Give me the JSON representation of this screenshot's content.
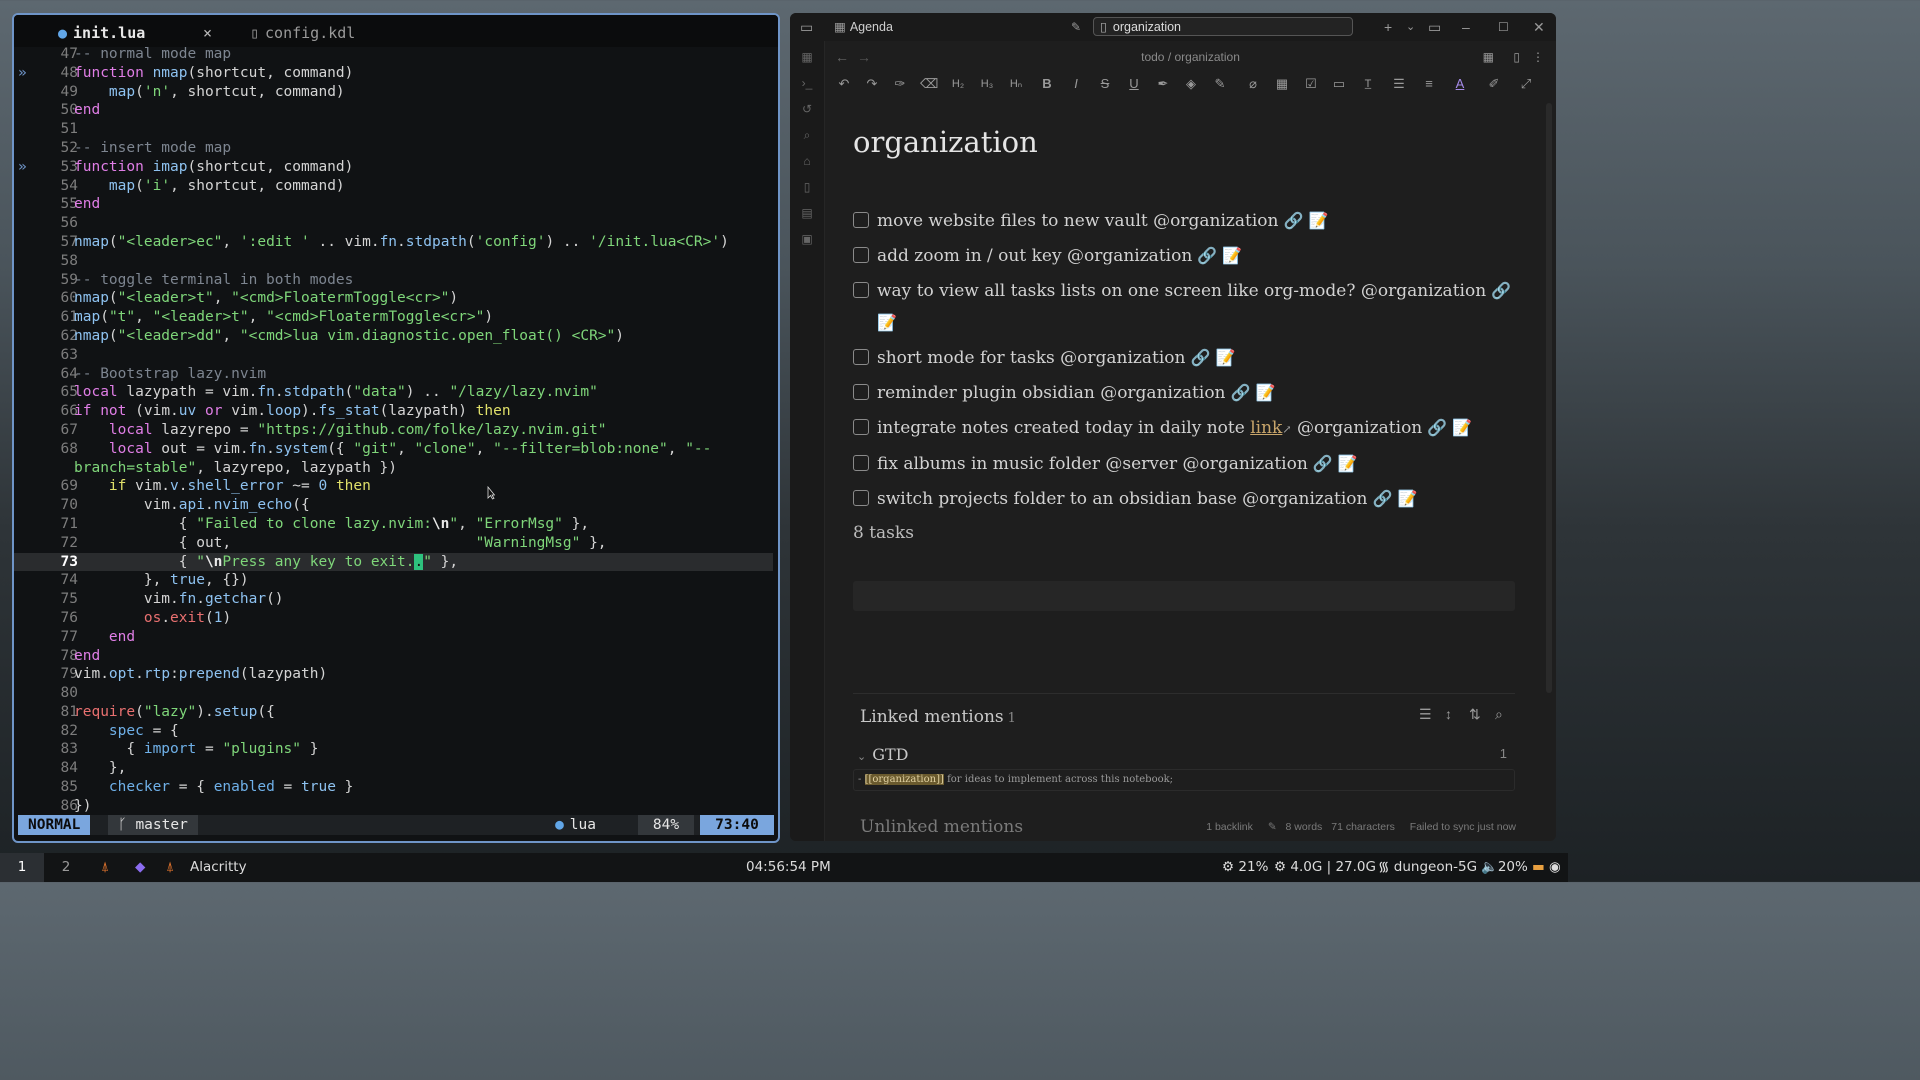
{
  "terminal": {
    "tabs": [
      {
        "label": "init.lua",
        "close": "×",
        "active": true
      },
      {
        "label": "config.kdl",
        "active": false
      }
    ],
    "lines": [
      {
        "n": "47",
        "t": [
          {
            "c": "cm",
            "s": "-- normal mode map"
          }
        ]
      },
      {
        "n": "48",
        "mark": "»",
        "t": [
          {
            "c": "kw",
            "s": "function"
          },
          {
            "s": " "
          },
          {
            "c": "fn",
            "s": "nmap"
          },
          {
            "s": "(shortcut, command)"
          }
        ]
      },
      {
        "n": "49",
        "t": [
          {
            "s": "    "
          },
          {
            "c": "fn",
            "s": "map"
          },
          {
            "s": "("
          },
          {
            "c": "str",
            "s": "'n'"
          },
          {
            "s": ", shortcut, command)"
          }
        ]
      },
      {
        "n": "50",
        "t": [
          {
            "c": "kw",
            "s": "end"
          }
        ]
      },
      {
        "n": "51",
        "t": []
      },
      {
        "n": "52",
        "t": [
          {
            "c": "cm",
            "s": "-- insert mode map"
          }
        ]
      },
      {
        "n": "53",
        "mark": "»",
        "t": [
          {
            "c": "kw",
            "s": "function"
          },
          {
            "s": " "
          },
          {
            "c": "fn",
            "s": "imap"
          },
          {
            "s": "(shortcut, command)"
          }
        ]
      },
      {
        "n": "54",
        "t": [
          {
            "s": "    "
          },
          {
            "c": "fn",
            "s": "map"
          },
          {
            "s": "("
          },
          {
            "c": "str",
            "s": "'i'"
          },
          {
            "s": ", shortcut, command)"
          }
        ]
      },
      {
        "n": "55",
        "t": [
          {
            "c": "kw",
            "s": "end"
          }
        ]
      },
      {
        "n": "56",
        "t": []
      },
      {
        "n": "57",
        "t": [
          {
            "c": "fn",
            "s": "nmap"
          },
          {
            "s": "("
          },
          {
            "c": "str",
            "s": "\"<leader>ec\""
          },
          {
            "s": ", "
          },
          {
            "c": "str",
            "s": "':edit '"
          },
          {
            "s": " .. vim."
          },
          {
            "c": "fn",
            "s": "fn"
          },
          {
            "s": "."
          },
          {
            "c": "fn",
            "s": "stdpath"
          },
          {
            "s": "("
          },
          {
            "c": "str",
            "s": "'config'"
          },
          {
            "s": ") .. "
          },
          {
            "c": "str",
            "s": "'/init.lua<CR>'"
          },
          {
            "s": ")"
          }
        ]
      },
      {
        "n": "58",
        "t": []
      },
      {
        "n": "59",
        "t": [
          {
            "c": "cm",
            "s": "-- toggle terminal in both modes"
          }
        ]
      },
      {
        "n": "60",
        "t": [
          {
            "c": "fn",
            "s": "nmap"
          },
          {
            "s": "("
          },
          {
            "c": "str",
            "s": "\"<leader>t\""
          },
          {
            "s": ", "
          },
          {
            "c": "str",
            "s": "\"<cmd>FloatermToggle<cr>\""
          },
          {
            "s": ")"
          }
        ]
      },
      {
        "n": "61",
        "t": [
          {
            "c": "fn",
            "s": "map"
          },
          {
            "s": "("
          },
          {
            "c": "str",
            "s": "\"t\""
          },
          {
            "s": ", "
          },
          {
            "c": "str",
            "s": "\"<leader>t\""
          },
          {
            "s": ", "
          },
          {
            "c": "str",
            "s": "\"<cmd>FloatermToggle<cr>\""
          },
          {
            "s": ")"
          }
        ]
      },
      {
        "n": "62",
        "t": [
          {
            "c": "fn",
            "s": "nmap"
          },
          {
            "s": "("
          },
          {
            "c": "str",
            "s": "\"<leader>dd\""
          },
          {
            "s": ", "
          },
          {
            "c": "str",
            "s": "\"<cmd>lua vim.diagnostic.open_float() <CR>\""
          },
          {
            "s": ")"
          }
        ]
      },
      {
        "n": "63",
        "t": []
      },
      {
        "n": "64",
        "t": [
          {
            "c": "cm",
            "s": "-- Bootstrap lazy.nvim"
          }
        ]
      },
      {
        "n": "65",
        "t": [
          {
            "c": "kw",
            "s": "local"
          },
          {
            "s": " lazypath = vim."
          },
          {
            "c": "fn",
            "s": "fn"
          },
          {
            "s": "."
          },
          {
            "c": "fn",
            "s": "stdpath"
          },
          {
            "s": "("
          },
          {
            "c": "str",
            "s": "\"data\""
          },
          {
            "s": ") .. "
          },
          {
            "c": "str",
            "s": "\"/lazy/lazy.nvim\""
          }
        ]
      },
      {
        "n": "66",
        "t": [
          {
            "c": "kw",
            "s": "if"
          },
          {
            "s": " "
          },
          {
            "c": "kw",
            "s": "not"
          },
          {
            "s": " (vim."
          },
          {
            "c": "fn",
            "s": "uv"
          },
          {
            "s": " "
          },
          {
            "c": "kw",
            "s": "or"
          },
          {
            "s": " vim."
          },
          {
            "c": "fn",
            "s": "loop"
          },
          {
            "s": ")."
          },
          {
            "c": "fn",
            "s": "fs_stat"
          },
          {
            "s": "(lazypath) "
          },
          {
            "c": "kw2",
            "s": "then"
          }
        ]
      },
      {
        "n": "67",
        "t": [
          {
            "s": "    "
          },
          {
            "c": "kw",
            "s": "local"
          },
          {
            "s": " lazyrepo = "
          },
          {
            "c": "str",
            "s": "\"https://github.com/folke/lazy.nvim.git\""
          }
        ]
      },
      {
        "n": "68",
        "t": [
          {
            "s": "    "
          },
          {
            "c": "kw",
            "s": "local"
          },
          {
            "s": " out = vim."
          },
          {
            "c": "fn",
            "s": "fn"
          },
          {
            "s": "."
          },
          {
            "c": "fn",
            "s": "system"
          },
          {
            "s": "({ "
          },
          {
            "c": "str",
            "s": "\"git\""
          },
          {
            "s": ", "
          },
          {
            "c": "str",
            "s": "\"clone\""
          },
          {
            "s": ", "
          },
          {
            "c": "str",
            "s": "\"--filter=blob:none\""
          },
          {
            "s": ", "
          },
          {
            "c": "str",
            "s": "\"--"
          }
        ]
      },
      {
        "n": "",
        "t": [
          {
            "c": "str",
            "s": "branch=stable\""
          },
          {
            "s": ", lazyrepo, lazypath })"
          }
        ]
      },
      {
        "n": "69",
        "t": [
          {
            "s": "    "
          },
          {
            "c": "kw2",
            "s": "if"
          },
          {
            "s": " vim."
          },
          {
            "c": "fn",
            "s": "v"
          },
          {
            "s": "."
          },
          {
            "c": "fn",
            "s": "shell_error"
          },
          {
            "s": " ~= "
          },
          {
            "c": "fn",
            "s": "0"
          },
          {
            "s": " "
          },
          {
            "c": "kw2",
            "s": "then"
          }
        ]
      },
      {
        "n": "70",
        "t": [
          {
            "s": "        vim."
          },
          {
            "c": "fn",
            "s": "api"
          },
          {
            "s": "."
          },
          {
            "c": "fn",
            "s": "nvim_echo"
          },
          {
            "s": "({"
          }
        ]
      },
      {
        "n": "71",
        "t": [
          {
            "s": "            { "
          },
          {
            "c": "str",
            "s": "\"Failed to clone lazy.nvim:"
          },
          {
            "c": "esc",
            "s": "\\n"
          },
          {
            "c": "str",
            "s": "\""
          },
          {
            "s": ", "
          },
          {
            "c": "str",
            "s": "\"ErrorMsg\""
          },
          {
            "s": " },"
          }
        ]
      },
      {
        "n": "72",
        "t": [
          {
            "s": "            { out,                            "
          },
          {
            "c": "str",
            "s": "\"WarningMsg\""
          },
          {
            "s": " },"
          }
        ]
      },
      {
        "n": "73",
        "cur": true,
        "t": [
          {
            "s": "            { "
          },
          {
            "c": "str",
            "s": "\""
          },
          {
            "c": "esc",
            "s": "\\n"
          },
          {
            "c": "str",
            "s": "Press any key to exit."
          },
          {
            "c": "cursor",
            "s": "."
          },
          {
            "c": "str",
            "s": "\""
          },
          {
            "s": " },"
          }
        ]
      },
      {
        "n": "74",
        "t": [
          {
            "s": "        }, "
          },
          {
            "c": "fn",
            "s": "true"
          },
          {
            "s": ", {})"
          }
        ]
      },
      {
        "n": "75",
        "t": [
          {
            "s": "        vim."
          },
          {
            "c": "fn",
            "s": "fn"
          },
          {
            "s": "."
          },
          {
            "c": "fn",
            "s": "getchar"
          },
          {
            "s": "()"
          }
        ]
      },
      {
        "n": "76",
        "t": [
          {
            "s": "        "
          },
          {
            "c": "rd",
            "s": "os"
          },
          {
            "s": "."
          },
          {
            "c": "rd",
            "s": "exit"
          },
          {
            "s": "("
          },
          {
            "c": "fn",
            "s": "1"
          },
          {
            "s": ")"
          }
        ]
      },
      {
        "n": "77",
        "t": [
          {
            "s": "    "
          },
          {
            "c": "kw",
            "s": "end"
          }
        ]
      },
      {
        "n": "78",
        "t": [
          {
            "c": "kw",
            "s": "end"
          }
        ]
      },
      {
        "n": "79",
        "t": [
          {
            "s": "vim."
          },
          {
            "c": "fn",
            "s": "opt"
          },
          {
            "s": "."
          },
          {
            "c": "fn",
            "s": "rtp"
          },
          {
            "s": ":"
          },
          {
            "c": "fn",
            "s": "prepend"
          },
          {
            "s": "(lazypath)"
          }
        ]
      },
      {
        "n": "80",
        "t": []
      },
      {
        "n": "81",
        "t": [
          {
            "c": "rd",
            "s": "require"
          },
          {
            "s": "("
          },
          {
            "c": "str",
            "s": "\"lazy\""
          },
          {
            "s": ")."
          },
          {
            "c": "fn",
            "s": "setup"
          },
          {
            "s": "({"
          }
        ]
      },
      {
        "n": "82",
        "t": [
          {
            "s": "    "
          },
          {
            "c": "fld",
            "s": "spec"
          },
          {
            "s": " = {"
          }
        ]
      },
      {
        "n": "83",
        "t": [
          {
            "s": "      { "
          },
          {
            "c": "fld",
            "s": "import"
          },
          {
            "s": " = "
          },
          {
            "c": "str",
            "s": "\"plugins\""
          },
          {
            "s": " }"
          }
        ]
      },
      {
        "n": "84",
        "t": [
          {
            "s": "    },"
          }
        ]
      },
      {
        "n": "85",
        "t": [
          {
            "s": "    "
          },
          {
            "c": "fld",
            "s": "checker"
          },
          {
            "s": " = { "
          },
          {
            "c": "fld",
            "s": "enabled"
          },
          {
            "s": " = "
          },
          {
            "c": "fn",
            "s": "true"
          },
          {
            "s": " }"
          }
        ]
      },
      {
        "n": "86",
        "t": [
          {
            "s": "})"
          }
        ]
      }
    ],
    "status": {
      "mode": "NORMAL",
      "branch": "master",
      "filetype": "lua",
      "percent": "84%",
      "position": "73:40"
    }
  },
  "obsidian": {
    "tab_title": "Agenda",
    "search_value": "organization",
    "breadcrumb": "todo / organization",
    "note_title": "organization",
    "tasks": [
      {
        "text": "move website files to new vault @organization"
      },
      {
        "text": "add zoom in / out key @organization"
      },
      {
        "text": "way to view all tasks lists on one screen like org-mode? @organization"
      },
      {
        "text": "short mode for tasks @organization"
      },
      {
        "text": "reminder plugin obsidian @organization"
      },
      {
        "pre": "integrate notes created today in daily note ",
        "link": "link",
        "post": " @organization"
      },
      {
        "text": "fix albums in music folder @server @organization"
      },
      {
        "text": "switch projects folder to an obsidian base @organization"
      }
    ],
    "task_count": "8 tasks",
    "linked_mentions": {
      "label": "Linked mentions",
      "count": "1"
    },
    "gtd": {
      "label": "GTD",
      "count": "1",
      "context_link": "[[organization]]",
      "context_text": " for ideas to implement across this notebook;",
      "context_prefix": "- "
    },
    "unlinked_mentions": "Unlinked mentions",
    "statusbar": {
      "backlinks": "1 backlink",
      "words": "8 words",
      "chars": "71 characters",
      "sync": "Failed to sync just now"
    }
  },
  "taskbar": {
    "workspaces": [
      "1",
      "2"
    ],
    "app": "Alacritty",
    "clock": "04:56:54 PM",
    "cpu": "21%",
    "memory": "4.0G | 27.0G",
    "wifi": "dungeon-5G",
    "volume": "20%"
  }
}
